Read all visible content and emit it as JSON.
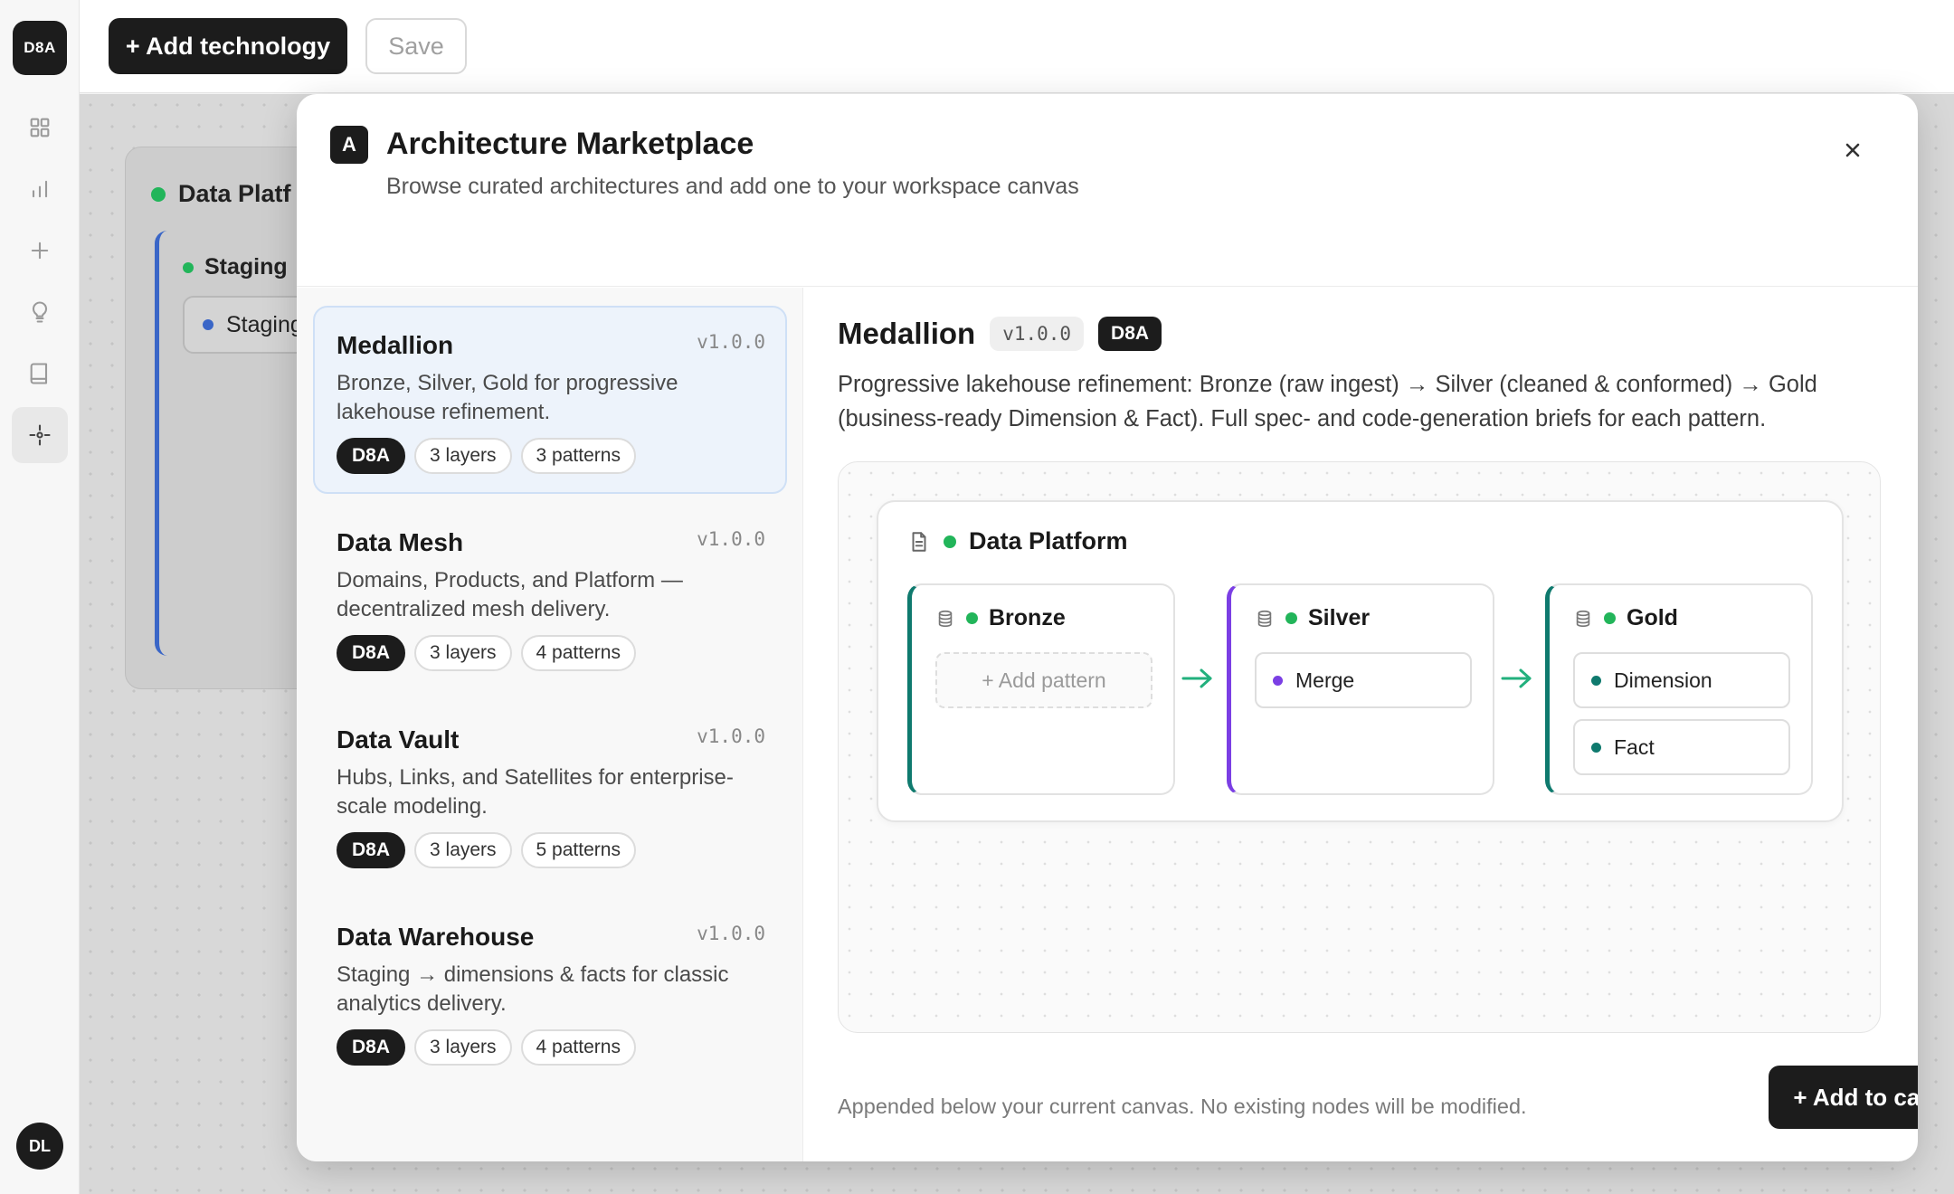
{
  "rail": {
    "logo": "D8A",
    "nav": [
      {
        "name": "dashboard-grid-icon"
      },
      {
        "name": "bar-chart-icon"
      },
      {
        "name": "plus-icon"
      },
      {
        "name": "lightbulb-icon"
      },
      {
        "name": "book-icon"
      },
      {
        "name": "architecture-icon",
        "active": true
      }
    ],
    "avatar": "DL"
  },
  "toolbar": {
    "add_technology": "+ Add technology",
    "save": "Save"
  },
  "canvas_bg": {
    "card_title": "Data Platf",
    "stage_title": "Staging",
    "stage_pill": "Staging"
  },
  "modal": {
    "badge": "A",
    "title": "Architecture Marketplace",
    "subtitle": "Browse curated architectures and add one to your workspace canvas",
    "architectures": [
      {
        "name": "Medallion",
        "version": "v1.0.0",
        "description": "Bronze, Silver, Gold for progressive lakehouse refinement.",
        "tags": [
          "D8A",
          "3 layers",
          "3 patterns"
        ],
        "selected": true
      },
      {
        "name": "Data Mesh",
        "version": "v1.0.0",
        "description": "Domains, Products, and Platform — decentralized mesh delivery.",
        "tags": [
          "D8A",
          "3 layers",
          "4 patterns"
        ]
      },
      {
        "name": "Data Vault",
        "version": "v1.0.0",
        "description": "Hubs, Links, and Satellites for enterprise-scale modeling.",
        "tags": [
          "D8A",
          "3 layers",
          "5 patterns"
        ]
      },
      {
        "name": "Data Warehouse",
        "version": "v1.0.0",
        "description": "Staging → dimensions & facts for classic analytics delivery.",
        "tags": [
          "D8A",
          "3 layers",
          "4 patterns"
        ]
      }
    ],
    "detail": {
      "title": "Medallion",
      "version": "v1.0.0",
      "owner": "D8A",
      "description": "Progressive lakehouse refinement: Bronze (raw ingest) → Silver (cleaned & conformed) → Gold (business-ready Dimension & Fact). Full spec- and code-generation briefs for each pattern.",
      "preview": {
        "platform": "Data Platform",
        "layers": [
          {
            "name": "Bronze",
            "color": "#0f7a6e",
            "add_pattern": "+ Add pattern",
            "patterns": []
          },
          {
            "name": "Silver",
            "color": "#7b3fe4",
            "patterns": [
              {
                "name": "Merge",
                "dot": "#7b3fe4"
              }
            ]
          },
          {
            "name": "Gold",
            "color": "#0f7a6e",
            "patterns": [
              {
                "name": "Dimension",
                "dot": "#0f7a6e"
              },
              {
                "name": "Fact",
                "dot": "#0f7a6e"
              }
            ]
          }
        ]
      },
      "note": "Appended below your current canvas. No existing nodes will be modified.",
      "add_to_canvas": "+ Add to canvas"
    }
  },
  "colors": {
    "status_green": "#22b55a",
    "accent_dark": "#1c1c1c",
    "selected_bg": "#edf3fb",
    "arrow": "#22b07d"
  }
}
